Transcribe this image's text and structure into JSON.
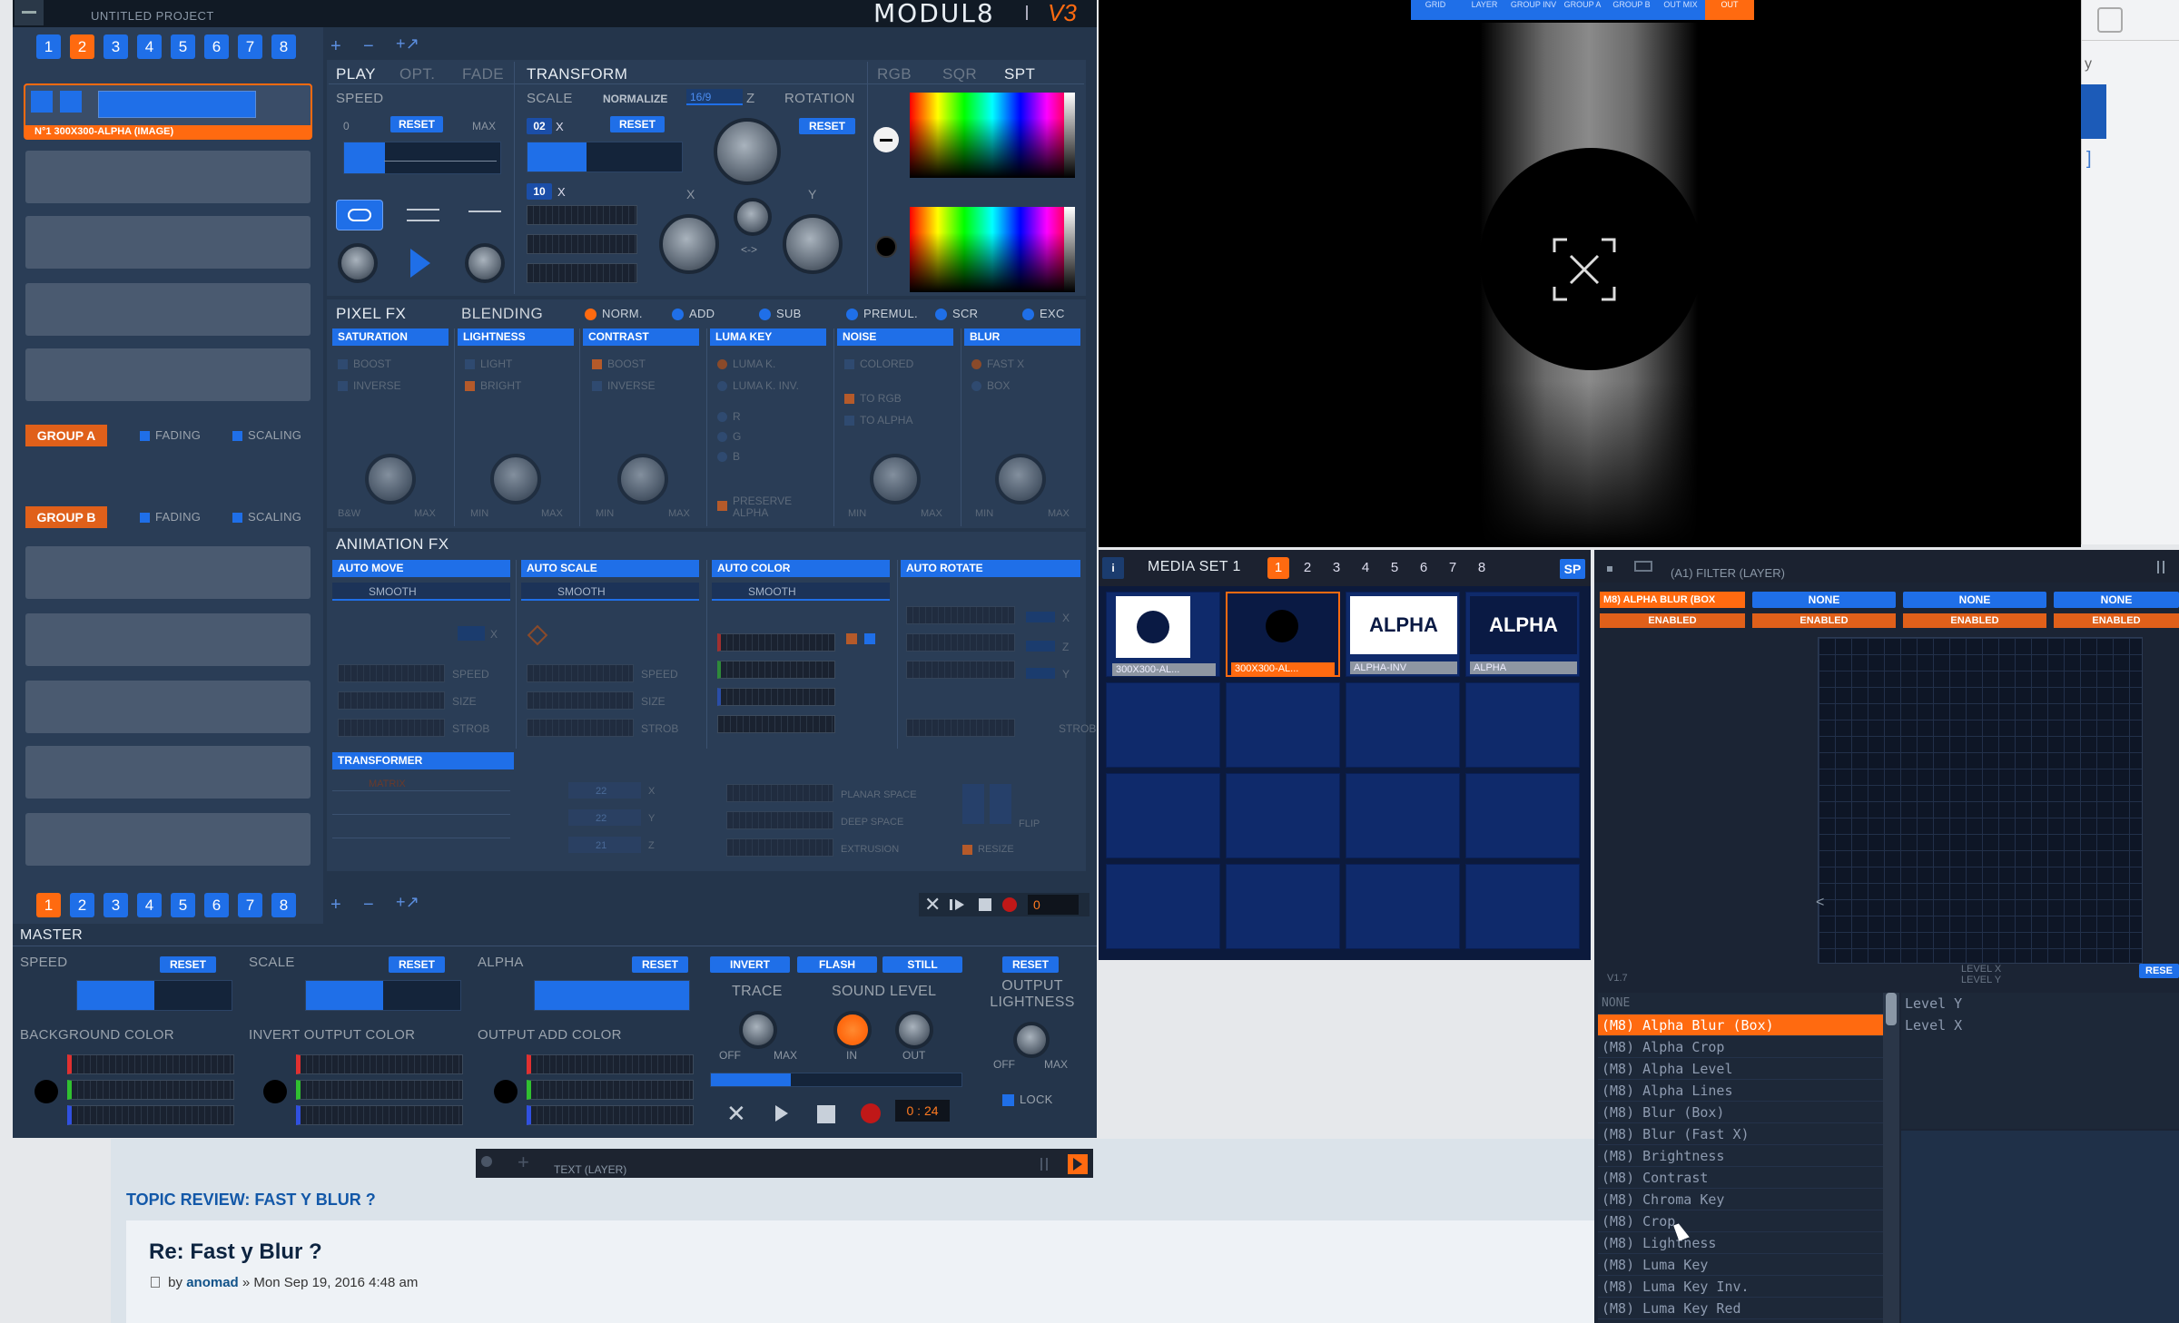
{
  "app": {
    "title": "UNTITLED PROJECT",
    "logo": "MODUL8",
    "version": "V3"
  },
  "layers": {
    "tabs": [
      "1",
      "2",
      "3",
      "4",
      "5",
      "6",
      "7",
      "8"
    ],
    "active": "2",
    "add": "+",
    "remove": "−",
    "link": "+↗",
    "layer1_name": "N°1 300X300-ALPHA (IMAGE)",
    "group_a": "GROUP A",
    "group_b": "GROUP B",
    "fading": "FADING",
    "scaling": "SCALING"
  },
  "panel_tabs": {
    "play": "PLAY",
    "opt": "OPT.",
    "fade": "FADE",
    "transform": "TRANSFORM",
    "rgb": "RGB",
    "sqr": "SQR",
    "spt": "SPT"
  },
  "play": {
    "speed": "SPEED",
    "zero": "0",
    "reset": "RESET",
    "max": "MAX"
  },
  "transform": {
    "scale": "SCALE",
    "normalize": "NORMALIZE",
    "ratio": "16/9",
    "z": "Z",
    "rotation": "ROTATION",
    "reset": "RESET",
    "x_label": "X",
    "y_label": "Y",
    "swap": "<->",
    "scale_x": "02",
    "scale_x2": "10"
  },
  "pixelfx": {
    "title": "PIXEL FX",
    "blending": "BLENDING",
    "modes": [
      "NORM.",
      "ADD",
      "SUB",
      "PREMUL.",
      "SCR",
      "EXC"
    ],
    "sections": [
      "SATURATION",
      "LIGHTNESS",
      "CONTRAST",
      "LUMA KEY",
      "NOISE",
      "BLUR"
    ],
    "sat": [
      "BOOST",
      "INVERSE"
    ],
    "light": [
      "LIGHT",
      "BRIGHT"
    ],
    "contrast": [
      "BOOST",
      "INVERSE"
    ],
    "luma": [
      "LUMA K.",
      "LUMA K. INV.",
      "R",
      "G",
      "B",
      "PRESERVE",
      "ALPHA"
    ],
    "noise": [
      "COLORED",
      "TO RGB",
      "TO ALPHA"
    ],
    "blur": [
      "FAST X",
      "BOX"
    ],
    "knob_labels": [
      "B&W",
      "MAX",
      "MIN",
      "MAX",
      "MIN",
      "MAX",
      "MIN",
      "MAX",
      "MIN",
      "MAX"
    ]
  },
  "animfx": {
    "title": "ANIMATION FX",
    "sections": [
      "AUTO MOVE",
      "AUTO SCALE",
      "AUTO COLOR",
      "AUTO ROTATE"
    ],
    "mode": "SMOOTH",
    "speed": "SPEED",
    "size": "SIZE",
    "strob": "STROB",
    "x": "X",
    "z": "Z",
    "y": "Y",
    "transformer": "TRANSFORMER",
    "matrix": "MATRIX",
    "planar": "PLANAR SPACE",
    "deep": "DEEP SPACE",
    "extrusion": "EXTRUSION",
    "flip": "FLIP",
    "resize": "RESIZE",
    "t_x": "X",
    "t_y": "Y",
    "t_z": "Z",
    "v1": "22",
    "v2": "22",
    "v3": "21"
  },
  "bottom_tabs": [
    "1",
    "2",
    "3",
    "4",
    "5",
    "6",
    "7",
    "8"
  ],
  "transport": {
    "counter": "0"
  },
  "master": {
    "title": "MASTER",
    "speed": "SPEED",
    "scale": "SCALE",
    "alpha": "ALPHA",
    "reset": "RESET",
    "invert": "INVERT",
    "flash": "FLASH",
    "still": "STILL",
    "trace": "TRACE",
    "sound_level": "SOUND LEVEL",
    "off": "OFF",
    "max": "MAX",
    "in": "IN",
    "out": "OUT",
    "output_lightness": "OUTPUT LIGHTNESS",
    "bg_color": "BACKGROUND COLOR",
    "invert_color": "INVERT OUTPUT COLOR",
    "add_color": "OUTPUT ADD COLOR",
    "lock": "LOCK",
    "time": "0 : 24",
    "speed_level": 0.5,
    "scale_level": 0.5,
    "alpha_level": 1.0
  },
  "text_layer": {
    "label": "TEXT (LAYER)"
  },
  "top_strip": [
    "GRID",
    "LAYER",
    "GROUP INV",
    "GROUP A",
    "GROUP B",
    "OUT MIX",
    "OUT"
  ],
  "media": {
    "info": "i",
    "title": "MEDIA SET 1",
    "tabs": [
      "1",
      "2",
      "3",
      "4",
      "5",
      "6",
      "7",
      "8"
    ],
    "sp": "SP",
    "items": [
      {
        "label": "300X300-AL..."
      },
      {
        "label": "300X300-AL..."
      },
      {
        "label": "ALPHA-INV",
        "text": "ALPHA"
      },
      {
        "label": "ALPHA",
        "text": "ALPHA"
      }
    ]
  },
  "filter": {
    "title": "(A1) FILTER (LAYER)",
    "slots": [
      "M8) ALPHA BLUR (BOX",
      "NONE",
      "NONE",
      "NONE"
    ],
    "enabled": "ENABLED",
    "version": "V1.7",
    "level_x": "LEVEL X",
    "level_y": "LEVEL Y",
    "reset": "RESE",
    "chevron": "<",
    "list": [
      "NONE",
      "(M8) Alpha Blur (Box)",
      "(M8) Alpha Crop",
      "(M8) Alpha Level",
      "(M8) Alpha Lines",
      "(M8) Blur (Box)",
      "(M8) Blur (Fast X)",
      "(M8) Brightness",
      "(M8) Contrast",
      "(M8) Chroma Key",
      "(M8) Crop",
      "(M8) Lightness",
      "(M8) Luma Key",
      "(M8) Luma Key Inv.",
      "(M8) Luma Key Red"
    ],
    "params": [
      "Level Y",
      "Level X"
    ]
  },
  "forum": {
    "topic": "TOPIC REVIEW: FAST Y BLUR ?",
    "post_title": "Re: Fast y Blur ?",
    "by": "by",
    "author": "anomad",
    "date": "» Mon Sep 19, 2016 4:48 am"
  },
  "browser": {
    "y": "y",
    "bracket": "]"
  }
}
